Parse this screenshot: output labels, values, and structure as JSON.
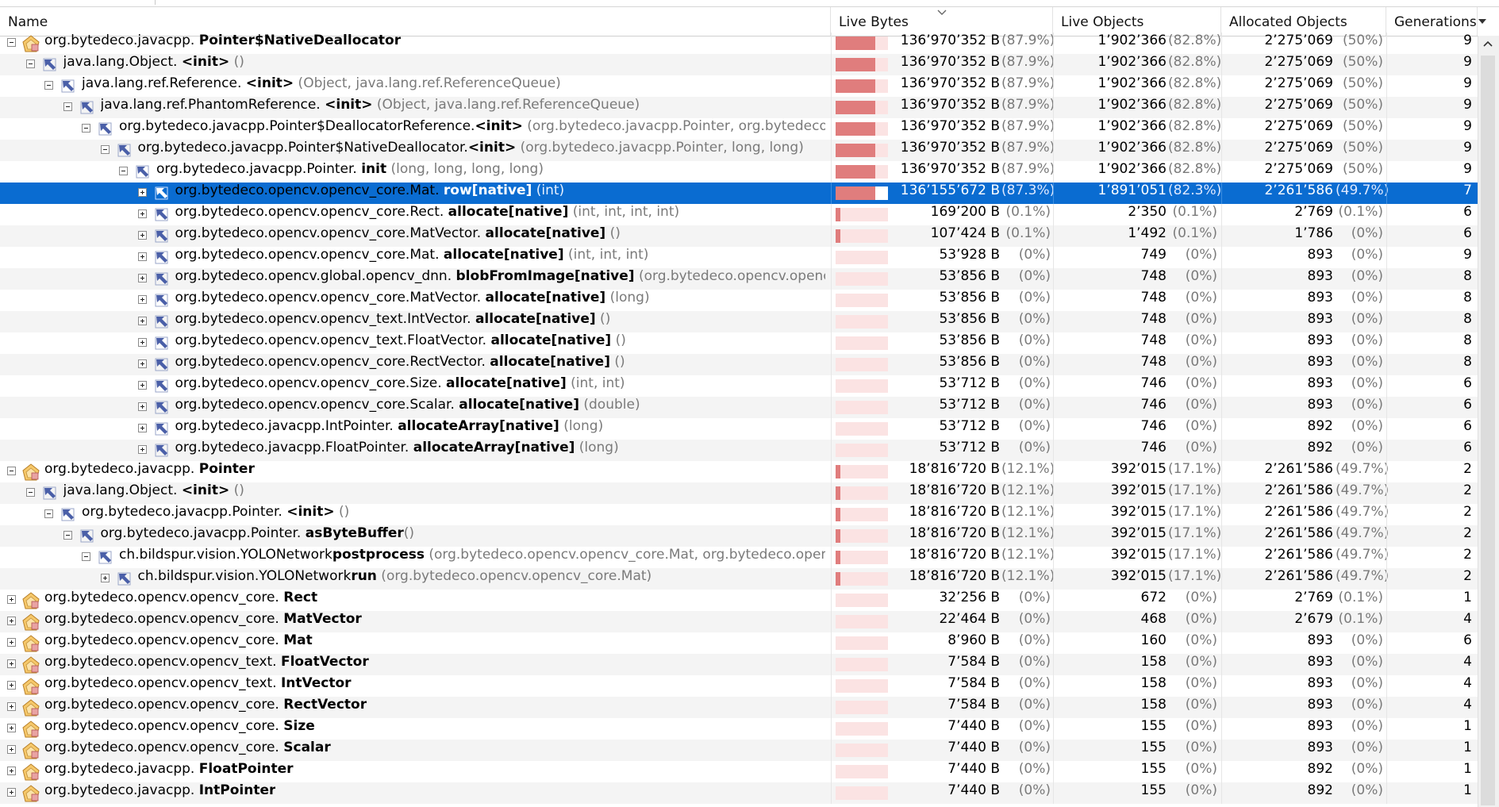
{
  "table": {
    "columns": [
      {
        "key": "name",
        "label": "Name"
      },
      {
        "key": "live_bytes",
        "label": "Live Bytes"
      },
      {
        "key": "live_objects",
        "label": "Live Objects"
      },
      {
        "key": "allocated_objects",
        "label": "Allocated Objects"
      },
      {
        "key": "generations",
        "label": "Generations"
      }
    ],
    "sorted_by": "live_bytes",
    "rows": [
      {
        "depth": 0,
        "toggle": "minus",
        "icon": "class-icon",
        "pkg": "org.bytedeco.javacpp. ",
        "name": "Pointer$NativeDeallocator",
        "args": "",
        "lb": "136’970’352 B",
        "lbp": "(87.9%)",
        "bar": 0.879,
        "lo": "1’902’366",
        "lop": "(82.8%)",
        "ao": "2’275’069",
        "aop": "(50%)",
        "gen": "9"
      },
      {
        "depth": 1,
        "toggle": "minus",
        "icon": "method-icon",
        "pkg": "java.lang.Object. ",
        "name": "<init>",
        "args": " ()",
        "lb": "136’970’352 B",
        "lbp": "(87.9%)",
        "bar": 0.879,
        "lo": "1’902’366",
        "lop": "(82.8%)",
        "ao": "2’275’069",
        "aop": "(50%)",
        "gen": "9"
      },
      {
        "depth": 2,
        "toggle": "minus",
        "icon": "method-icon",
        "pkg": "java.lang.ref.Reference. ",
        "name": "<init>",
        "args": " (Object, java.lang.ref.ReferenceQueue)",
        "lb": "136’970’352 B",
        "lbp": "(87.9%)",
        "bar": 0.879,
        "lo": "1’902’366",
        "lop": "(82.8%)",
        "ao": "2’275’069",
        "aop": "(50%)",
        "gen": "9"
      },
      {
        "depth": 3,
        "toggle": "minus",
        "icon": "method-icon",
        "pkg": "java.lang.ref.PhantomReference. ",
        "name": "<init>",
        "args": " (Object, java.lang.ref.ReferenceQueue)",
        "lb": "136’970’352 B",
        "lbp": "(87.9%)",
        "bar": 0.879,
        "lo": "1’902’366",
        "lop": "(82.8%)",
        "ao": "2’275’069",
        "aop": "(50%)",
        "gen": "9"
      },
      {
        "depth": 4,
        "toggle": "minus",
        "icon": "method-icon",
        "pkg": "org.bytedeco.javacpp.Pointer$DeallocatorReference.",
        "name": "<init>",
        "args": " (org.bytedeco.javacpp.Pointer, org.bytedeco.javacpp.Poi",
        "lb": "136’970’352 B",
        "lbp": "(87.9%)",
        "bar": 0.879,
        "lo": "1’902’366",
        "lop": "(82.8%)",
        "ao": "2’275’069",
        "aop": "(50%)",
        "gen": "9"
      },
      {
        "depth": 5,
        "toggle": "minus",
        "icon": "method-icon",
        "pkg": "org.bytedeco.javacpp.Pointer$NativeDeallocator.",
        "name": "<init>",
        "args": " (org.bytedeco.javacpp.Pointer, long, long)",
        "lb": "136’970’352 B",
        "lbp": "(87.9%)",
        "bar": 0.879,
        "lo": "1’902’366",
        "lop": "(82.8%)",
        "ao": "2’275’069",
        "aop": "(50%)",
        "gen": "9"
      },
      {
        "depth": 6,
        "toggle": "minus",
        "icon": "method-icon",
        "pkg": "org.bytedeco.javacpp.Pointer. ",
        "name": "init",
        "args": " (long, long, long, long)",
        "lb": "136’970’352 B",
        "lbp": "(87.9%)",
        "bar": 0.879,
        "lo": "1’902’366",
        "lop": "(82.8%)",
        "ao": "2’275’069",
        "aop": "(50%)",
        "gen": "9"
      },
      {
        "depth": 7,
        "toggle": "plus",
        "icon": "method-icon",
        "selected": true,
        "pkg": "org.bytedeco.opencv.opencv_core.Mat. ",
        "name": "row[native]",
        "args": " (int)",
        "lb": "136’155’672 B",
        "lbp": "(87.3%)",
        "bar": 0.873,
        "lo": "1’891’051",
        "lop": "(82.3%)",
        "ao": "2’261’586",
        "aop": "(49.7%)",
        "gen": "7"
      },
      {
        "depth": 7,
        "toggle": "plus",
        "icon": "method-icon",
        "pkg": "org.bytedeco.opencv.opencv_core.Rect. ",
        "name": "allocate[native]",
        "args": " (int, int, int, int)",
        "lb": "169’200 B",
        "lbp": "(0.1%)",
        "bar": 0.001,
        "lo": "2’350",
        "lop": "(0.1%)",
        "ao": "2’769",
        "aop": "(0.1%)",
        "gen": "6"
      },
      {
        "depth": 7,
        "toggle": "plus",
        "icon": "method-icon",
        "pkg": "org.bytedeco.opencv.opencv_core.MatVector. ",
        "name": "allocate[native]",
        "args": " ()",
        "lb": "107’424 B",
        "lbp": "(0.1%)",
        "bar": 0.001,
        "lo": "1’492",
        "lop": "(0.1%)",
        "ao": "1’786",
        "aop": "(0%)",
        "gen": "6"
      },
      {
        "depth": 7,
        "toggle": "plus",
        "icon": "method-icon",
        "pkg": "org.bytedeco.opencv.opencv_core.Mat. ",
        "name": "allocate[native]",
        "args": " (int, int, int)",
        "lb": "53’928 B",
        "lbp": "(0%)",
        "bar": 0,
        "lo": "749",
        "lop": "(0%)",
        "ao": "893",
        "aop": "(0%)",
        "gen": "9"
      },
      {
        "depth": 7,
        "toggle": "plus",
        "icon": "method-icon",
        "pkg": "org.bytedeco.opencv.global.opencv_dnn. ",
        "name": "blobFromImage[native]",
        "args": " (org.bytedeco.opencv.opencv_core.",
        "lb": "53’856 B",
        "lbp": "(0%)",
        "bar": 0,
        "lo": "748",
        "lop": "(0%)",
        "ao": "893",
        "aop": "(0%)",
        "gen": "8"
      },
      {
        "depth": 7,
        "toggle": "plus",
        "icon": "method-icon",
        "pkg": "org.bytedeco.opencv.opencv_core.MatVector. ",
        "name": "allocate[native]",
        "args": " (long)",
        "lb": "53’856 B",
        "lbp": "(0%)",
        "bar": 0,
        "lo": "748",
        "lop": "(0%)",
        "ao": "893",
        "aop": "(0%)",
        "gen": "8"
      },
      {
        "depth": 7,
        "toggle": "plus",
        "icon": "method-icon",
        "pkg": "org.bytedeco.opencv.opencv_text.IntVector. ",
        "name": "allocate[native]",
        "args": " ()",
        "lb": "53’856 B",
        "lbp": "(0%)",
        "bar": 0,
        "lo": "748",
        "lop": "(0%)",
        "ao": "893",
        "aop": "(0%)",
        "gen": "8"
      },
      {
        "depth": 7,
        "toggle": "plus",
        "icon": "method-icon",
        "pkg": "org.bytedeco.opencv.opencv_text.FloatVector. ",
        "name": "allocate[native]",
        "args": " ()",
        "lb": "53’856 B",
        "lbp": "(0%)",
        "bar": 0,
        "lo": "748",
        "lop": "(0%)",
        "ao": "893",
        "aop": "(0%)",
        "gen": "8"
      },
      {
        "depth": 7,
        "toggle": "plus",
        "icon": "method-icon",
        "pkg": "org.bytedeco.opencv.opencv_core.RectVector. ",
        "name": "allocate[native]",
        "args": " ()",
        "lb": "53’856 B",
        "lbp": "(0%)",
        "bar": 0,
        "lo": "748",
        "lop": "(0%)",
        "ao": "893",
        "aop": "(0%)",
        "gen": "8"
      },
      {
        "depth": 7,
        "toggle": "plus",
        "icon": "method-icon",
        "pkg": "org.bytedeco.opencv.opencv_core.Size. ",
        "name": "allocate[native]",
        "args": " (int, int)",
        "lb": "53’712 B",
        "lbp": "(0%)",
        "bar": 0,
        "lo": "746",
        "lop": "(0%)",
        "ao": "893",
        "aop": "(0%)",
        "gen": "6"
      },
      {
        "depth": 7,
        "toggle": "plus",
        "icon": "method-icon",
        "pkg": "org.bytedeco.opencv.opencv_core.Scalar. ",
        "name": "allocate[native]",
        "args": " (double)",
        "lb": "53’712 B",
        "lbp": "(0%)",
        "bar": 0,
        "lo": "746",
        "lop": "(0%)",
        "ao": "893",
        "aop": "(0%)",
        "gen": "6"
      },
      {
        "depth": 7,
        "toggle": "plus",
        "icon": "method-icon",
        "pkg": "org.bytedeco.javacpp.IntPointer. ",
        "name": "allocateArray[native]",
        "args": " (long)",
        "lb": "53’712 B",
        "lbp": "(0%)",
        "bar": 0,
        "lo": "746",
        "lop": "(0%)",
        "ao": "892",
        "aop": "(0%)",
        "gen": "6"
      },
      {
        "depth": 7,
        "toggle": "plus",
        "icon": "method-icon",
        "pkg": "org.bytedeco.javacpp.FloatPointer. ",
        "name": "allocateArray[native]",
        "args": " (long)",
        "lb": "53’712 B",
        "lbp": "(0%)",
        "bar": 0,
        "lo": "746",
        "lop": "(0%)",
        "ao": "892",
        "aop": "(0%)",
        "gen": "6"
      },
      {
        "depth": 0,
        "toggle": "minus",
        "icon": "class-icon",
        "pkg": "org.bytedeco.javacpp. ",
        "name": "Pointer",
        "args": "",
        "lb": "18’816’720 B",
        "lbp": "(12.1%)",
        "bar": 0.121,
        "lo": "392’015",
        "lop": "(17.1%)",
        "ao": "2’261’586",
        "aop": "(49.7%)",
        "gen": "2"
      },
      {
        "depth": 1,
        "toggle": "minus",
        "icon": "method-icon",
        "pkg": "java.lang.Object. ",
        "name": "<init>",
        "args": " ()",
        "lb": "18’816’720 B",
        "lbp": "(12.1%)",
        "bar": 0.121,
        "lo": "392’015",
        "lop": "(17.1%)",
        "ao": "2’261’586",
        "aop": "(49.7%)",
        "gen": "2"
      },
      {
        "depth": 2,
        "toggle": "minus",
        "icon": "method-icon",
        "pkg": "org.bytedeco.javacpp.Pointer. ",
        "name": "<init>",
        "args": " ()",
        "lb": "18’816’720 B",
        "lbp": "(12.1%)",
        "bar": 0.121,
        "lo": "392’015",
        "lop": "(17.1%)",
        "ao": "2’261’586",
        "aop": "(49.7%)",
        "gen": "2"
      },
      {
        "depth": 3,
        "toggle": "minus",
        "icon": "method-icon",
        "pkg": "org.bytedeco.javacpp.Pointer. ",
        "name": "asByteBuffer",
        "args": "()",
        "lb": "18’816’720 B",
        "lbp": "(12.1%)",
        "bar": 0.121,
        "lo": "392’015",
        "lop": "(17.1%)",
        "ao": "2’261’586",
        "aop": "(49.7%)",
        "gen": "2"
      },
      {
        "depth": 4,
        "toggle": "minus",
        "icon": "method-icon",
        "pkg": "ch.bildspur.vision.YOLONetwork",
        "name": "postprocess",
        "args": " (org.bytedeco.opencv.opencv_core.Mat, org.bytedeco.opencv.opencv_",
        "lb": "18’816’720 B",
        "lbp": "(12.1%)",
        "bar": 0.121,
        "lo": "392’015",
        "lop": "(17.1%)",
        "ao": "2’261’586",
        "aop": "(49.7%)",
        "gen": "2"
      },
      {
        "depth": 5,
        "toggle": "plus",
        "icon": "method-icon",
        "pkg": "ch.bildspur.vision.YOLONetwork",
        "name": "run",
        "args": " (org.bytedeco.opencv.opencv_core.Mat)",
        "lb": "18’816’720 B",
        "lbp": "(12.1%)",
        "bar": 0.121,
        "lo": "392’015",
        "lop": "(17.1%)",
        "ao": "2’261’586",
        "aop": "(49.7%)",
        "gen": "2"
      },
      {
        "depth": 0,
        "toggle": "plus",
        "icon": "class-icon",
        "pkg": "org.bytedeco.opencv.opencv_core. ",
        "name": "Rect",
        "args": "",
        "lb": "32’256 B",
        "lbp": "(0%)",
        "bar": 0,
        "lo": "672",
        "lop": "(0%)",
        "ao": "2’769",
        "aop": "(0.1%)",
        "gen": "1"
      },
      {
        "depth": 0,
        "toggle": "plus",
        "icon": "class-icon",
        "pkg": "org.bytedeco.opencv.opencv_core. ",
        "name": "MatVector",
        "args": "",
        "lb": "22’464 B",
        "lbp": "(0%)",
        "bar": 0,
        "lo": "468",
        "lop": "(0%)",
        "ao": "2’679",
        "aop": "(0.1%)",
        "gen": "4"
      },
      {
        "depth": 0,
        "toggle": "plus",
        "icon": "class-icon",
        "pkg": "org.bytedeco.opencv.opencv_core. ",
        "name": "Mat",
        "args": "",
        "lb": "8’960 B",
        "lbp": "(0%)",
        "bar": 0,
        "lo": "160",
        "lop": "(0%)",
        "ao": "893",
        "aop": "(0%)",
        "gen": "6"
      },
      {
        "depth": 0,
        "toggle": "plus",
        "icon": "class-icon",
        "pkg": "org.bytedeco.opencv.opencv_text. ",
        "name": "FloatVector",
        "args": "",
        "lb": "7’584 B",
        "lbp": "(0%)",
        "bar": 0,
        "lo": "158",
        "lop": "(0%)",
        "ao": "893",
        "aop": "(0%)",
        "gen": "4"
      },
      {
        "depth": 0,
        "toggle": "plus",
        "icon": "class-icon",
        "pkg": "org.bytedeco.opencv.opencv_text. ",
        "name": "IntVector",
        "args": "",
        "lb": "7’584 B",
        "lbp": "(0%)",
        "bar": 0,
        "lo": "158",
        "lop": "(0%)",
        "ao": "893",
        "aop": "(0%)",
        "gen": "4"
      },
      {
        "depth": 0,
        "toggle": "plus",
        "icon": "class-icon",
        "pkg": "org.bytedeco.opencv.opencv_core. ",
        "name": "RectVector",
        "args": "",
        "lb": "7’584 B",
        "lbp": "(0%)",
        "bar": 0,
        "lo": "158",
        "lop": "(0%)",
        "ao": "893",
        "aop": "(0%)",
        "gen": "4"
      },
      {
        "depth": 0,
        "toggle": "plus",
        "icon": "class-icon",
        "pkg": "org.bytedeco.opencv.opencv_core. ",
        "name": "Size",
        "args": "",
        "lb": "7’440 B",
        "lbp": "(0%)",
        "bar": 0,
        "lo": "155",
        "lop": "(0%)",
        "ao": "893",
        "aop": "(0%)",
        "gen": "1"
      },
      {
        "depth": 0,
        "toggle": "plus",
        "icon": "class-icon",
        "pkg": "org.bytedeco.opencv.opencv_core. ",
        "name": "Scalar",
        "args": "",
        "lb": "7’440 B",
        "lbp": "(0%)",
        "bar": 0,
        "lo": "155",
        "lop": "(0%)",
        "ao": "893",
        "aop": "(0%)",
        "gen": "1"
      },
      {
        "depth": 0,
        "toggle": "plus",
        "icon": "class-icon",
        "pkg": "org.bytedeco.javacpp. ",
        "name": "FloatPointer",
        "args": "",
        "lb": "7’440 B",
        "lbp": "(0%)",
        "bar": 0,
        "lo": "155",
        "lop": "(0%)",
        "ao": "892",
        "aop": "(0%)",
        "gen": "1"
      },
      {
        "depth": 0,
        "toggle": "plus",
        "icon": "class-icon",
        "pkg": "org.bytedeco.javacpp. ",
        "name": "IntPointer",
        "args": "",
        "lb": "7’440 B",
        "lbp": "(0%)",
        "bar": 0,
        "lo": "155",
        "lop": "(0%)",
        "ao": "892",
        "aop": "(0%)",
        "gen": "1"
      }
    ]
  },
  "colors": {
    "selection": "#0a6cd1",
    "bar_fill": "#e07d7d",
    "bar_background": "#fbe3e3",
    "secondary_text": "#7a7a7a"
  }
}
